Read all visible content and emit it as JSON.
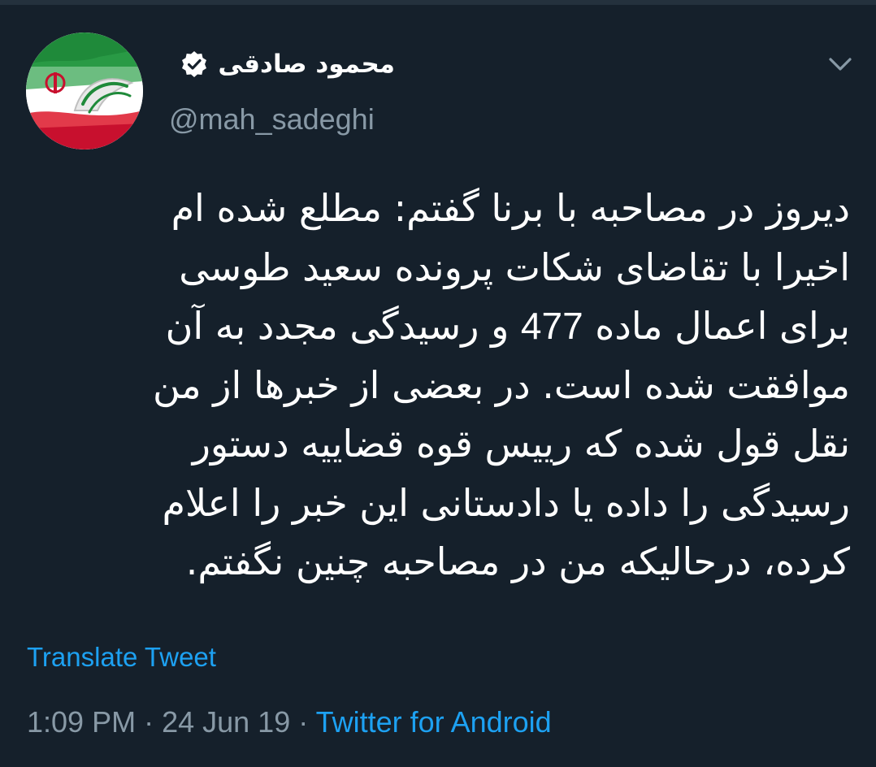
{
  "tweet": {
    "author": {
      "display_name": "محمود صادقی",
      "handle": "@mah_sadeghi",
      "verified": true
    },
    "text_lines": [
      "دیروز در مصاحبه با برنا گفتم: مطلع شده ام",
      "اخیرا با تقاضای شکات پرونده سعید طوسی",
      "برای اعمال ماده",
      "477",
      "و رسیدگی مجدد به آن",
      "موافقت شده است. در بعضی از خبرها از من",
      "نقل قول شده که رییس قوه قضاییه دستور",
      "رسیدگی را داده یا دادستانی این خبر را اعلام",
      "کرده، درحالیکه من در مصاحبه چنین نگفتم."
    ],
    "translate_label": "Translate Tweet",
    "time": "1:09 PM",
    "separator": " · ",
    "date": "24 Jun 19",
    "source": "Twitter for Android"
  },
  "icons": {
    "verified": "verified-badge-icon",
    "menu": "chevron-down-icon"
  },
  "colors": {
    "background": "#15202b",
    "text_primary": "#ffffff",
    "text_secondary": "#8899a6",
    "accent": "#1da1f2"
  }
}
